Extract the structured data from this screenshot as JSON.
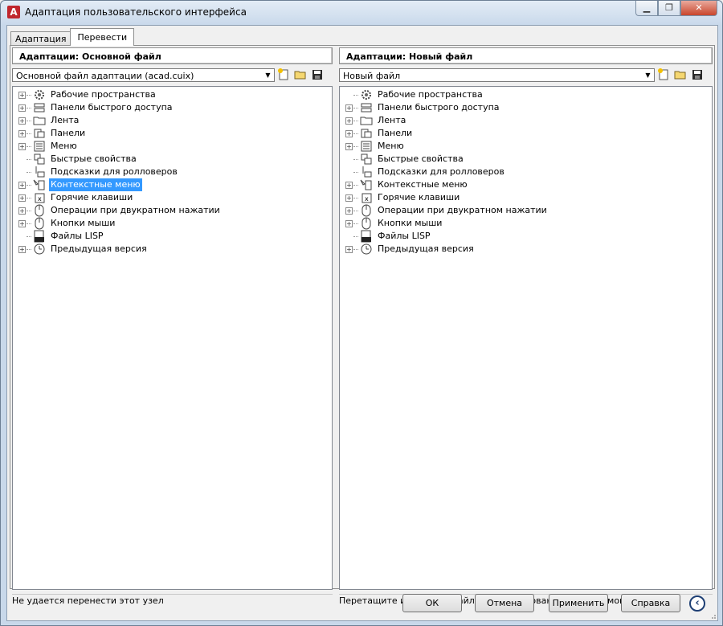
{
  "window": {
    "title": "Адаптация пользовательского интерфейса",
    "minimize": "▁",
    "restore": "❐",
    "close": "✕"
  },
  "tabs": [
    {
      "label": "Адаптация",
      "active": false
    },
    {
      "label": "Перевести",
      "active": true
    }
  ],
  "left_panel": {
    "header": "Адаптации: Основной файл",
    "combo_value": "Основной файл адаптации (acad.cuix)",
    "status": "Не удается перенести этот узел",
    "selected_item": "Контекстные меню"
  },
  "right_panel": {
    "header": "Адаптации: Новый файл",
    "combo_value": "Новый файл",
    "status": "Перетащите из любого файла для копирования содержимого"
  },
  "tree_items": [
    {
      "label": "Рабочие пространства",
      "icon": "gear-icon",
      "expandable_left": true,
      "expandable_right": false
    },
    {
      "label": "Панели быстрого доступа",
      "icon": "quick-access-toolbar-icon",
      "expandable_left": true,
      "expandable_right": true
    },
    {
      "label": "Лента",
      "icon": "ribbon-icon",
      "expandable_left": true,
      "expandable_right": true
    },
    {
      "label": "Панели",
      "icon": "toolbars-icon",
      "expandable_left": true,
      "expandable_right": true
    },
    {
      "label": "Меню",
      "icon": "menu-icon",
      "expandable_left": true,
      "expandable_right": true
    },
    {
      "label": "Быстрые свойства",
      "icon": "quick-properties-icon",
      "expandable_left": false,
      "expandable_right": false
    },
    {
      "label": "Подсказки для ролловеров",
      "icon": "rollover-tooltip-icon",
      "expandable_left": false,
      "expandable_right": false
    },
    {
      "label": "Контекстные меню",
      "icon": "context-menu-icon",
      "expandable_left": true,
      "expandable_right": true
    },
    {
      "label": "Горячие клавиши",
      "icon": "keyboard-shortcut-icon",
      "expandable_left": true,
      "expandable_right": true
    },
    {
      "label": "Операции при двукратном нажатии",
      "icon": "double-click-mouse-icon",
      "expandable_left": true,
      "expandable_right": true
    },
    {
      "label": "Кнопки мыши",
      "icon": "mouse-icon",
      "expandable_left": true,
      "expandable_right": true
    },
    {
      "label": "Файлы LISP",
      "icon": "lisp-file-icon",
      "expandable_left": false,
      "expandable_right": false
    },
    {
      "label": "Предыдущая версия",
      "icon": "legacy-clock-icon",
      "expandable_left": true,
      "expandable_right": true
    }
  ],
  "buttons": {
    "ok": "ОК",
    "cancel": "Отмена",
    "apply": "Применить",
    "help": "Справка"
  },
  "toolbar_icons": [
    "new-file-icon",
    "open-folder-icon",
    "save-icon"
  ]
}
